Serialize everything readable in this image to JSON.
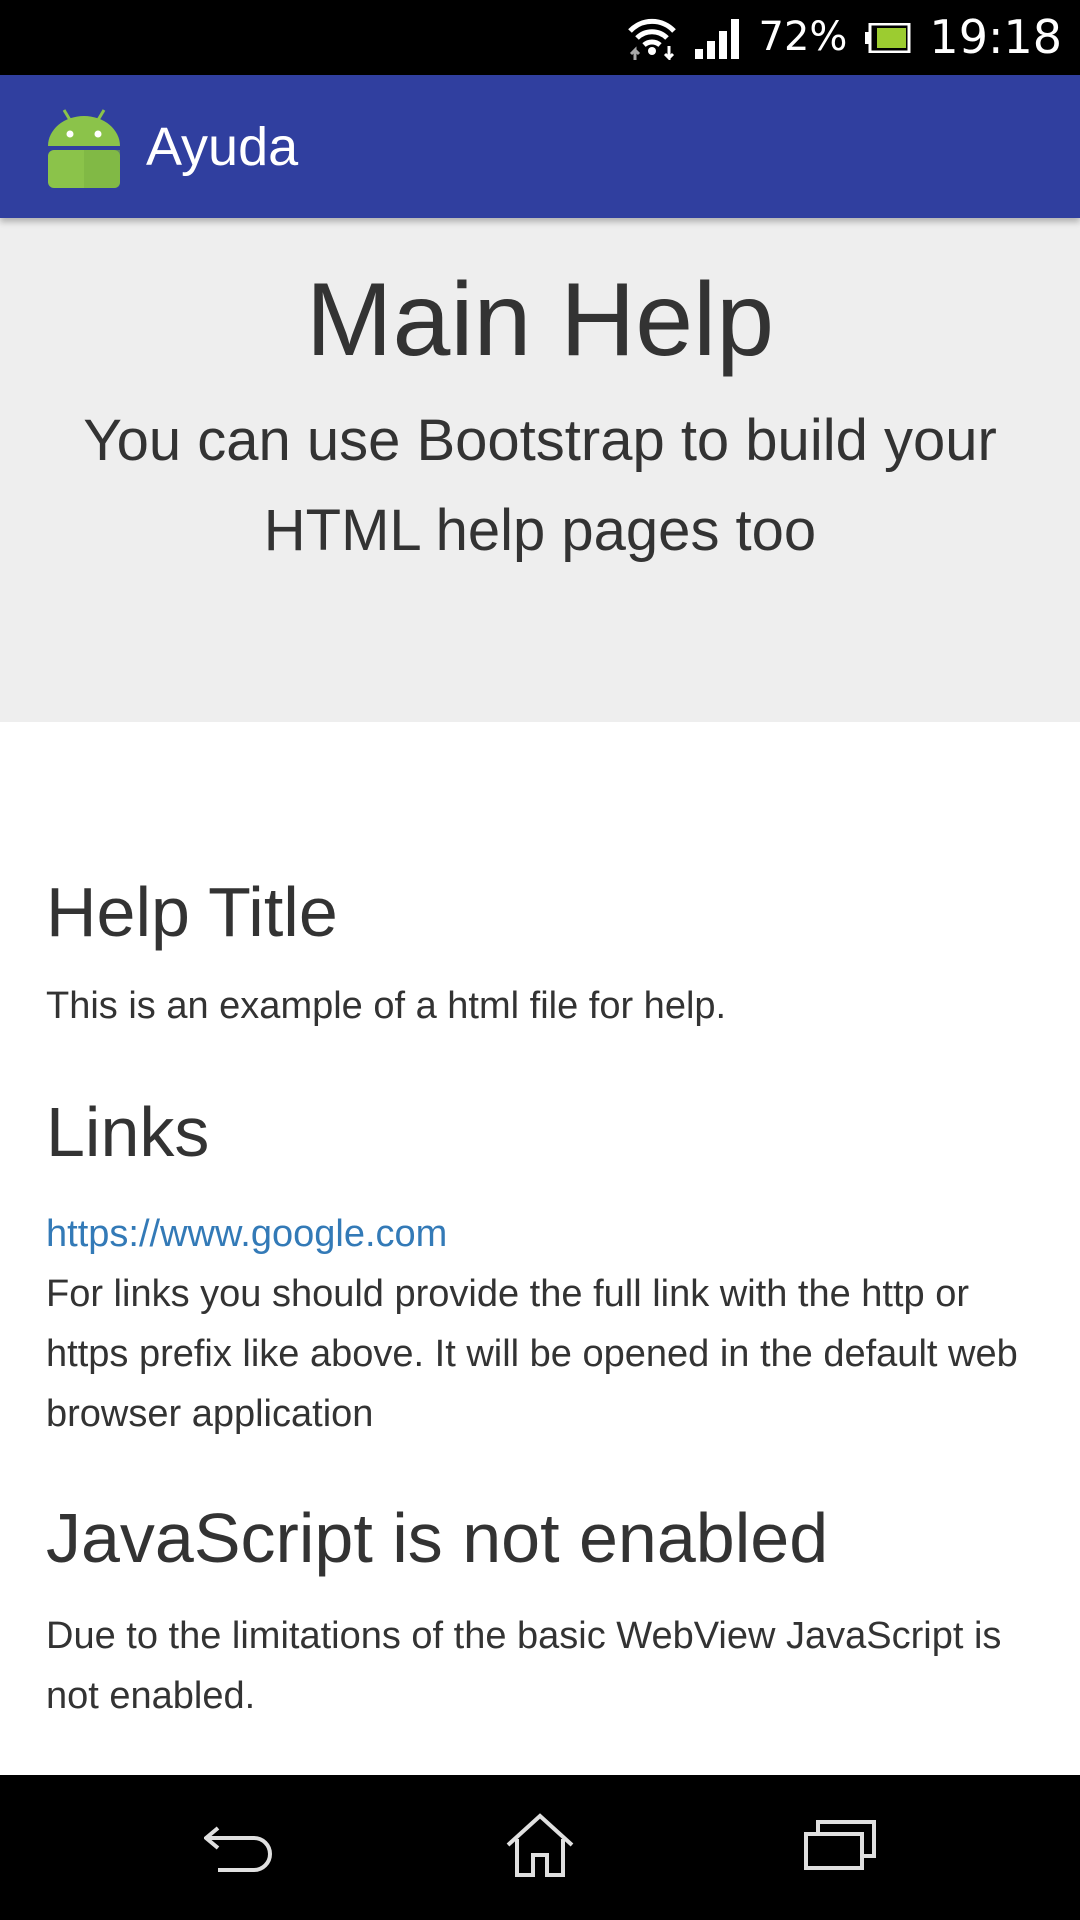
{
  "status_bar": {
    "battery_percent": "72%",
    "time": "19:18",
    "icons": [
      "wifi-icon",
      "signal-icon",
      "battery-icon"
    ]
  },
  "app_bar": {
    "title": "Ayuda",
    "icon": "android-icon",
    "color": "#303f9f"
  },
  "jumbotron": {
    "title": "Main Help",
    "lead": "You can use Bootstrap to build your HTML help pages too"
  },
  "sections": {
    "help": {
      "title": "Help Title",
      "text": "This is an example of a html file for help."
    },
    "links": {
      "title": "Links",
      "link": "https://www.google.com",
      "text": "For links you should provide the full link with the http or https prefix like above. It will be opened in the default web browser application"
    },
    "javascript": {
      "title": "JavaScript is not enabled",
      "text": "Due to the limitations of the basic WebView JavaScript is not enabled."
    }
  },
  "nav_bar": {
    "icons": [
      "back-icon",
      "home-icon",
      "recent-apps-icon"
    ]
  }
}
